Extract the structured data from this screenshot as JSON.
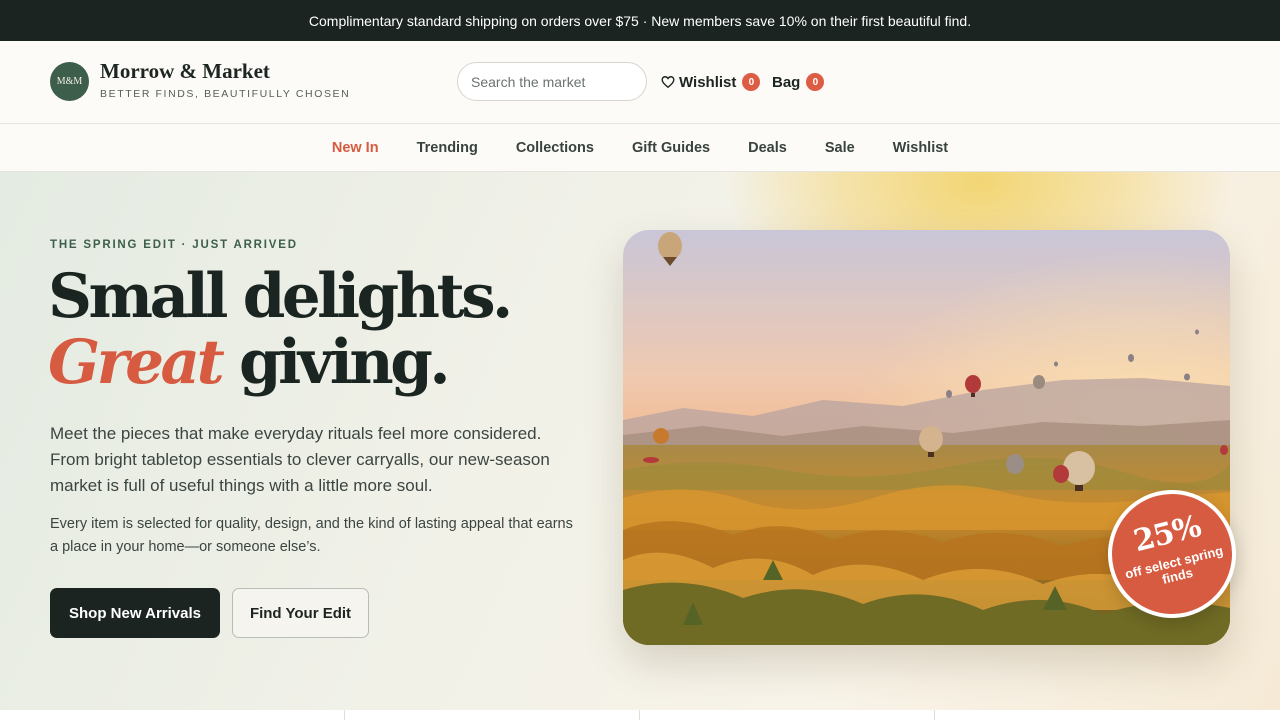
{
  "announcement": "Complimentary standard shipping on orders over $75 · New members save 10% on their first beautiful find.",
  "brand": {
    "monogram": "M&M",
    "name": "Morrow & Market",
    "tagline": "BETTER FINDS, BEAUTIFULLY CHOSEN"
  },
  "search": {
    "placeholder": "Search the market",
    "value": ""
  },
  "header_links": {
    "wishlist": {
      "label": "Wishlist",
      "count": "0",
      "icon": "heart-icon"
    },
    "bag": {
      "label": "Bag",
      "count": "0"
    }
  },
  "nav": {
    "active": "New In",
    "items": [
      "New In",
      "Trending",
      "Collections",
      "Gift Guides",
      "Deals",
      "Sale",
      "Wishlist"
    ]
  },
  "hero": {
    "eyebrow": "THE SPRING EDIT · JUST ARRIVED",
    "headline_line1": "Small delights.",
    "headline_accent": "Great",
    "headline_rest": " giving.",
    "lead": "Meet the pieces that make everyday rituals feel more considered. From bright tabletop essentials to clever carryalls, our new-season market is full of useful things with a little more soul.",
    "sub": "Every item is selected for quality, design, and the kind of lasting appeal that earns a place in your home—or someone else’s.",
    "primary_cta": "Shop New Arrivals",
    "secondary_cta": "Find Your Edit",
    "image": "hot-air-balloons-over-valley",
    "promo": {
      "big": "25%",
      "small": "off select spring finds"
    }
  },
  "colors": {
    "accent": "#d65b40",
    "brand_green": "#3d5e4b",
    "dark": "#1b2421"
  }
}
